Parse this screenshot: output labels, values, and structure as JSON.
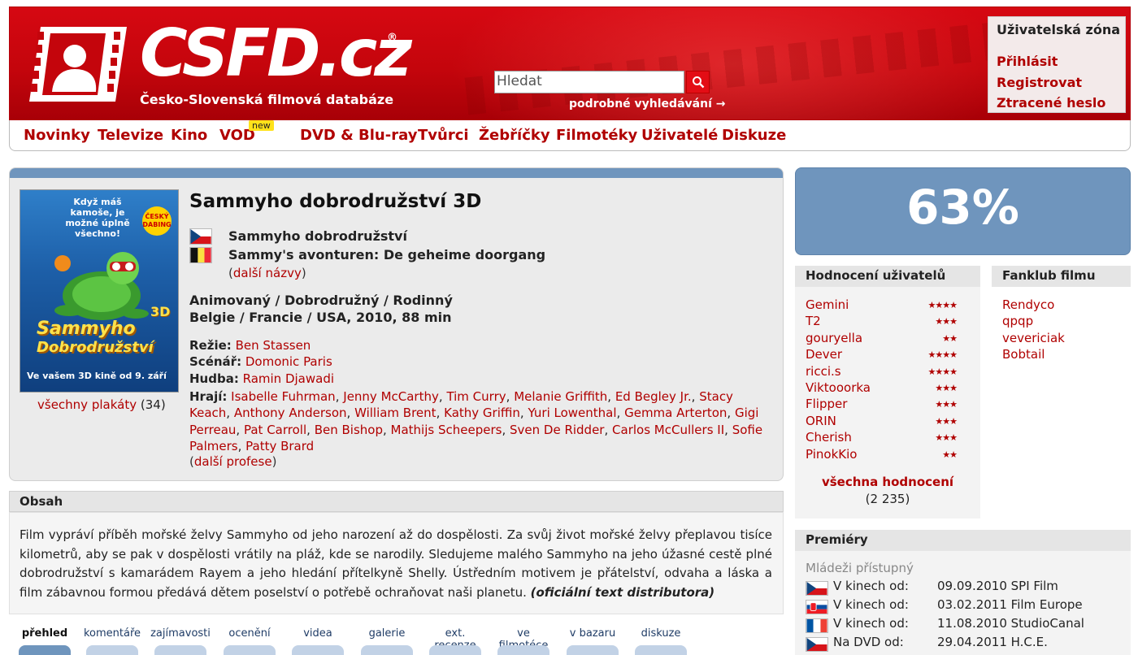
{
  "header": {
    "logo_text": "CSFD.cz",
    "logo_registered": "®",
    "subtitle": "Česko-Slovenská filmová databáze",
    "search_placeholder": "Hledat",
    "advanced_search": "podrobné vyhledávání →",
    "user_zone": {
      "title": "Uživatelská zóna",
      "links": [
        "Přihlásit",
        "Registrovat",
        "Ztracené heslo"
      ]
    }
  },
  "nav": {
    "items": [
      "Novinky",
      "Televize",
      "Kino",
      "VOD",
      "DVD & Blu-ray",
      "Tvůrci",
      "Žebříčky",
      "Filmotéky",
      "Uživatelé",
      "Diskuze"
    ],
    "new_badge": "new"
  },
  "movie": {
    "title": "Sammyho dobrodružství 3D",
    "alt_names": [
      {
        "flag": "cz",
        "name": "Sammyho dobrodružství"
      },
      {
        "flag": "be",
        "name": "Sammy's avonturen: De geheime doorgang"
      }
    ],
    "more_names": "další názvy",
    "genres": "Animovaný / Dobrodružný / Rodinný",
    "origin": "Belgie / Francie / USA, 2010, 88 min",
    "director_label": "Režie:",
    "director": "Ben Stassen",
    "writer_label": "Scénář:",
    "writer": "Domonic Paris",
    "music_label": "Hudba:",
    "music": "Ramin Djawadi",
    "cast_label": "Hrají:",
    "cast": [
      "Isabelle Fuhrman",
      "Jenny McCarthy",
      "Tim Curry",
      "Melanie Griffith",
      "Ed Begley Jr.",
      "Stacy Keach",
      "Anthony Anderson",
      "William Brent",
      "Kathy Griffin",
      "Yuri Lowenthal",
      "Gemma Arterton",
      "Gigi Perreau",
      "Pat Carroll",
      "Ben Bishop",
      "Mathijs Scheepers",
      "Sven De Ridder",
      "Carlos McCullers II",
      "Sofie Palmers",
      "Patty Brard"
    ],
    "more_professions": "další profese",
    "all_posters": "všechny plakáty",
    "posters_count": "(34)",
    "poster": {
      "tagline": "Když máš kamoše, je možné úplně všechno!",
      "badge": "ČESKÝ DABING",
      "title_line1": "Sammyho",
      "title_line2": "Dobrodružství",
      "footer": "Ve vašem 3D kině od 9. září",
      "threed": "3D"
    }
  },
  "synopsis": {
    "heading": "Obsah",
    "text": "Film vypráví příběh mořské želvy Sammyho od jeho narození až do dospělosti. Za svůj život mořské želvy přeplavou tisíce kilometrů, aby se pak v dospělosti vrátily na pláž, kde se narodily. Sledujeme malého Sammyho na jeho úžasné cestě plné dobrodružství s kamarádem Rayem a jeho hledání přítelkyně Shelly. Ústředním motivem je přátelství, odvaha a láska a film zábavnou formou předává dětem poselství o potřebě ochraňovat naši planetu.",
    "source": "(oficiální text distributora)"
  },
  "tabs": [
    "přehled",
    "komentáře",
    "zajímavosti",
    "ocenění",
    "videa",
    "galerie",
    "ext. recenze",
    "ve filmotéce",
    "v bazaru",
    "diskuze"
  ],
  "rating": {
    "percent": "63%"
  },
  "user_ratings": {
    "heading": "Hodnocení uživatelů",
    "rows": [
      {
        "user": "Gemini",
        "stars": "★★★★"
      },
      {
        "user": "T2",
        "stars": "★★★"
      },
      {
        "user": "gouryella",
        "stars": "★★"
      },
      {
        "user": "Dever",
        "stars": "★★★★"
      },
      {
        "user": "ricci.s",
        "stars": "★★★★"
      },
      {
        "user": "Viktooorka",
        "stars": "★★★"
      },
      {
        "user": "Flipper",
        "stars": "★★★"
      },
      {
        "user": "ORIN",
        "stars": "★★★"
      },
      {
        "user": "Cherish",
        "stars": "★★★"
      },
      {
        "user": "PinokKio",
        "stars": "★★"
      }
    ],
    "all_link": "všechna hodnocení",
    "count": "(2 235)"
  },
  "fanclub": {
    "heading": "Fanklub filmu",
    "members": [
      "Rendyco",
      "qpqp",
      "vevericiak",
      "Bobtail"
    ]
  },
  "premieres": {
    "heading": "Premiéry",
    "age": "Mládeži přístupný",
    "rows": [
      {
        "flag": "cz",
        "label": "V kinech od:",
        "date": "09.09.2010 SPI Film"
      },
      {
        "flag": "sk",
        "label": "V kinech od:",
        "date": "03.02.2011 Film Europe"
      },
      {
        "flag": "fr",
        "label": "V kinech od:",
        "date": "11.08.2010 StudioCanal"
      },
      {
        "flag": "cz",
        "label": "Na DVD od:",
        "date": "29.04.2011 H.C.E."
      }
    ]
  },
  "colors": {
    "brand_red": "#d60812",
    "link": "#b00000",
    "panel_blue": "#6f95bd"
  }
}
